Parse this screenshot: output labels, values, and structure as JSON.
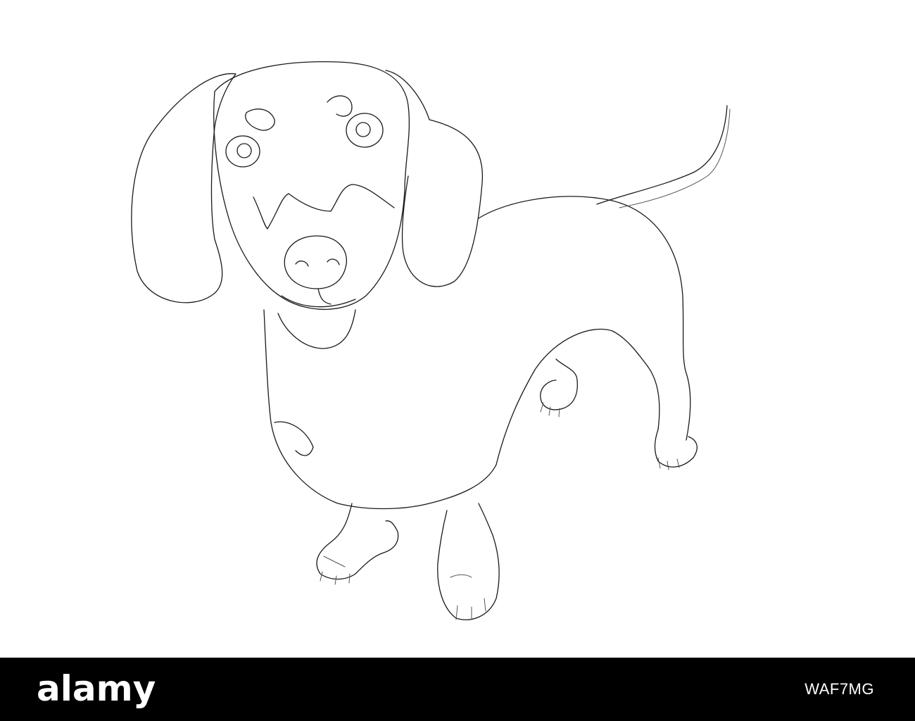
{
  "footer": {
    "brand": "alamy",
    "image_id": "WAF7MG"
  },
  "illustration": {
    "subject_icon": "dachshund-line-drawing",
    "stroke_color": "#1a1a1a",
    "background_color": "#ffffff",
    "footer_color": "#000000"
  }
}
